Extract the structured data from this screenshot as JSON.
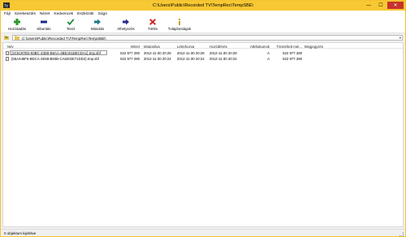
{
  "window": {
    "title": "C:\\Users\\Public\\Recorded TV\\TempRec\\TempSBE\\",
    "controls": {
      "minimize": "—",
      "maximize": "☐",
      "close": "✕"
    }
  },
  "menu": [
    "Fájl",
    "Szerkesztés",
    "Nézet",
    "Kedvencek",
    "Eszközök",
    "Súgó"
  ],
  "toolbar": [
    {
      "label": "Hozzáadás",
      "icon": "plus-icon",
      "color": "#2a9a2a"
    },
    {
      "label": "Kibontás",
      "icon": "minus-icon",
      "color": "#1b2a8a"
    },
    {
      "label": "Teszt",
      "icon": "checkmark-icon",
      "color": "#1f8a3a"
    },
    {
      "label": "Másolás",
      "icon": "copy-arrow-icon",
      "color": "#1c7a8a"
    },
    {
      "label": "Áthelyezés",
      "icon": "move-arrow-icon",
      "color": "#2a2a8a"
    },
    {
      "label": "Törlés",
      "icon": "delete-x-icon",
      "color": "#cc2222"
    },
    {
      "label": "Tulajdonságok",
      "icon": "info-icon",
      "color": "#c8a010"
    }
  ],
  "address": {
    "path": "C:\\Users\\Public\\Recorded TV\\TempRec\\TempSBE\\"
  },
  "columns": [
    "Név",
    "Méret",
    "Módosítva",
    "Létrehozva",
    "Hozzáférés",
    "Attribútumok",
    "Tömörített mér...",
    "Megjegyzés"
  ],
  "files": [
    {
      "name": "{2C6197ED-93BC-43D8-B6AA-4BEA51BECDA1}.tmp.sbf",
      "size": "522 977 280",
      "modified": "2012-11-30 20:28",
      "created": "2012-11-30 20:28",
      "accessed": "2012-11-30 20:28",
      "attributes": "A",
      "compressed": "522 977 280",
      "comment": ""
    },
    {
      "name": "{55A448F6-BDCA-4E59-B83B-CA8202E71DD2}.tmp.sbf",
      "size": "522 977 280",
      "modified": "2012-11-30 20:24",
      "created": "2012-11-30 20:24",
      "accessed": "2012-11-30 20:24",
      "attributes": "A",
      "compressed": "522 977 280",
      "comment": ""
    }
  ],
  "status": {
    "text": "0 objektum kijelölve"
  }
}
